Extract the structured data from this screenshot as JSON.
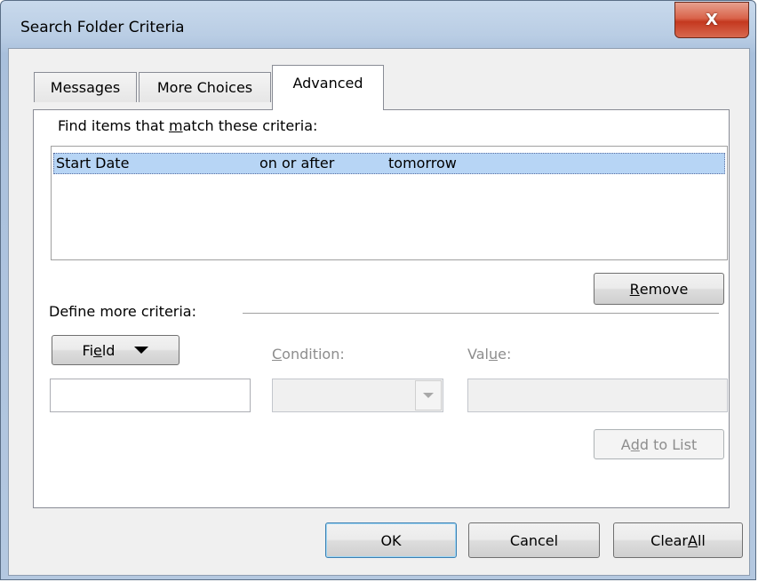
{
  "window": {
    "title": "Search Folder Criteria",
    "close_glyph": "X"
  },
  "tabs": [
    {
      "label": "Messages",
      "active": false
    },
    {
      "label": "More Choices",
      "active": false
    },
    {
      "label": "Advanced",
      "active": true
    }
  ],
  "advanced": {
    "criteria_label_pre": "Find items that ",
    "criteria_label_mnemonic": "m",
    "criteria_label_post": "atch these criteria:",
    "criteria_list": [
      {
        "field": "Start Date",
        "condition": "on or after",
        "value": "tomorrow",
        "selected": true
      }
    ],
    "remove_button_mnemonic": "R",
    "remove_button_rest": "emove",
    "define_more_label": "Define more criteria:",
    "field_button_pre": "Fi",
    "field_button_mnemonic": "e",
    "field_button_post": "ld",
    "field_input_value": "",
    "condition_label_mnemonic": "C",
    "condition_label_rest": "ondition:",
    "condition_select_value": "",
    "value_label_pre": "Val",
    "value_label_mnemonic": "u",
    "value_label_post": "e:",
    "value_input_value": "",
    "add_button_pre": "A",
    "add_button_mnemonic": "d",
    "add_button_post": "d to List"
  },
  "footer": {
    "ok_label": "OK",
    "cancel_label": "Cancel",
    "clear_all_pre": "Clear ",
    "clear_all_mnemonic": "A",
    "clear_all_post": "ll"
  },
  "colors": {
    "selection": "#b7d5f5",
    "close_button": "#c4381f",
    "default_button_border": "#3c7fb1"
  },
  "icons": {
    "close": "close-icon",
    "field_dropdown": "triangle-down-icon",
    "condition_dropdown": "chevron-down-icon"
  }
}
